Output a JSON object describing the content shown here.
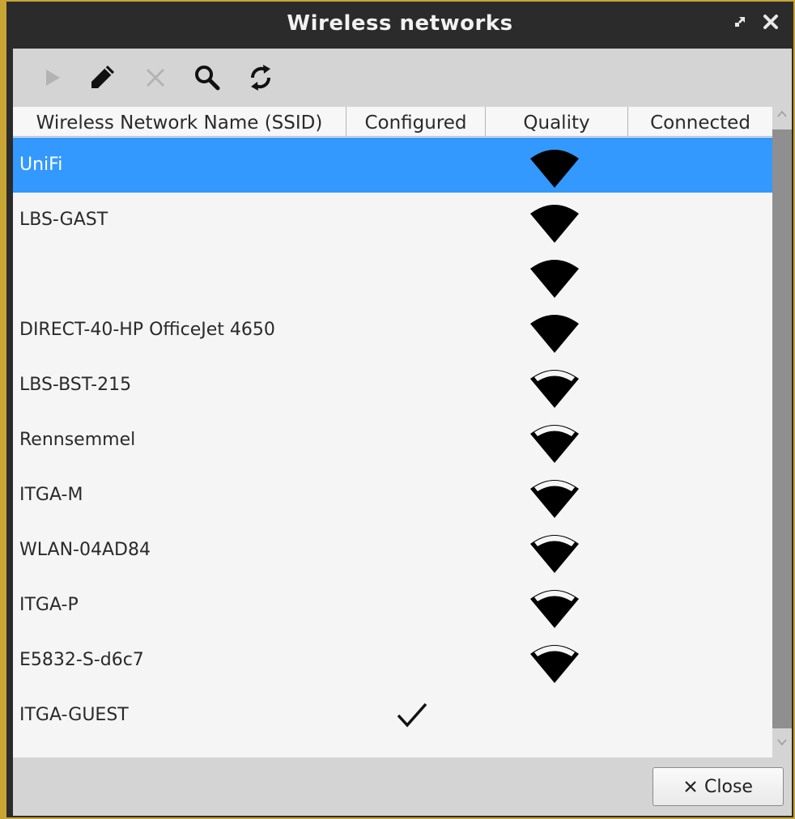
{
  "window": {
    "title": "Wireless networks",
    "maximize_icon": "expand-icon",
    "close_icon": "close-icon"
  },
  "toolbar": {
    "tools": [
      {
        "name": "connect-button",
        "icon": "play-icon",
        "enabled": false
      },
      {
        "name": "edit-button",
        "icon": "pencil-icon",
        "enabled": true
      },
      {
        "name": "delete-button",
        "icon": "x-icon",
        "enabled": false
      },
      {
        "name": "search-button",
        "icon": "magnifier-icon",
        "enabled": true
      },
      {
        "name": "refresh-button",
        "icon": "refresh-icon",
        "enabled": true
      }
    ]
  },
  "table": {
    "columns": [
      "Wireless Network Name (SSID)",
      "Configured",
      "Quality",
      "Connected"
    ],
    "rows": [
      {
        "ssid": "UniFi",
        "configured": false,
        "quality": "full",
        "connected": false,
        "selected": true
      },
      {
        "ssid": "LBS-GAST",
        "configured": false,
        "quality": "full",
        "connected": false,
        "selected": false
      },
      {
        "ssid": "",
        "configured": false,
        "quality": "full",
        "connected": false,
        "selected": false
      },
      {
        "ssid": "DIRECT-40-HP OfficeJet 4650",
        "configured": false,
        "quality": "full",
        "connected": false,
        "selected": false
      },
      {
        "ssid": "LBS-BST-215",
        "configured": false,
        "quality": "high",
        "connected": false,
        "selected": false
      },
      {
        "ssid": "Rennsemmel",
        "configured": false,
        "quality": "high",
        "connected": false,
        "selected": false
      },
      {
        "ssid": "ITGA-M",
        "configured": false,
        "quality": "high",
        "connected": false,
        "selected": false
      },
      {
        "ssid": "WLAN-04AD84",
        "configured": false,
        "quality": "high",
        "connected": false,
        "selected": false
      },
      {
        "ssid": "ITGA-P",
        "configured": false,
        "quality": "high",
        "connected": false,
        "selected": false
      },
      {
        "ssid": "E5832-S-d6c7",
        "configured": false,
        "quality": "high",
        "connected": false,
        "selected": false
      },
      {
        "ssid": "ITGA-GUEST",
        "configured": true,
        "quality": "none",
        "connected": false,
        "selected": false
      }
    ]
  },
  "footer": {
    "close_label": "Close",
    "close_icon": "x-icon"
  },
  "colors": {
    "selection": "#3399ff",
    "titlebar": "#2b2b2b",
    "frame_accent": "#c8a435"
  }
}
